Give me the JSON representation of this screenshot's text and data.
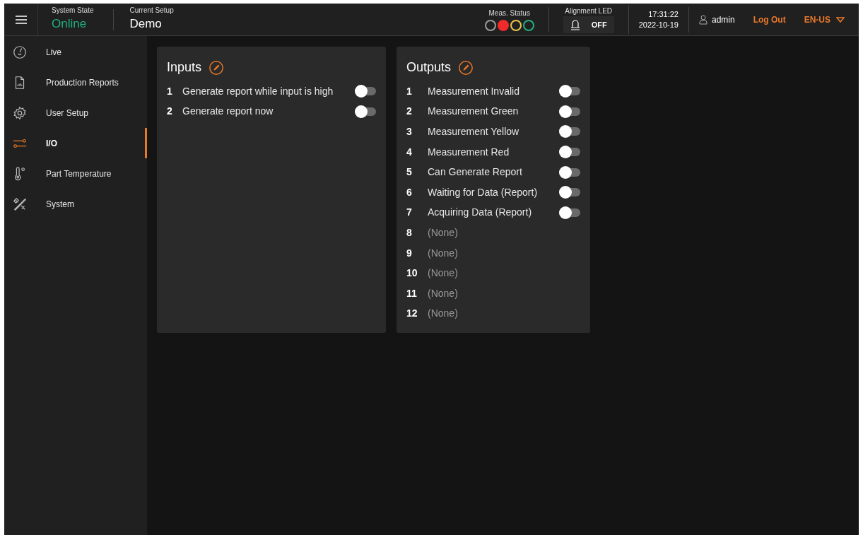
{
  "header": {
    "system_state": {
      "label": "System State",
      "value": "Online"
    },
    "current_setup": {
      "label": "Current Setup",
      "value": "Demo"
    },
    "meas_status": {
      "label": "Meas. Status",
      "dots": [
        {
          "color": "#9e9e9e",
          "filled": false
        },
        {
          "color": "#f02b2b",
          "filled": true
        },
        {
          "color": "#e8c54a",
          "filled": false
        },
        {
          "color": "#22b07d",
          "filled": false
        }
      ]
    },
    "alignment_led": {
      "label": "Alignment LED",
      "value": "OFF"
    },
    "time": "17:31:22",
    "date": "2022-10-19",
    "user": "admin",
    "logout": "Log Out",
    "language": "EN-US"
  },
  "sidebar": {
    "items": [
      {
        "label": "Live",
        "selected": false
      },
      {
        "label": "Production Reports",
        "selected": false
      },
      {
        "label": "User Setup",
        "selected": false
      },
      {
        "label": "I/O",
        "selected": true
      },
      {
        "label": "Part Temperature",
        "selected": false
      },
      {
        "label": "System",
        "selected": false
      }
    ]
  },
  "inputs": {
    "title": "Inputs",
    "rows": [
      {
        "number": "1",
        "label": "Generate report while input is high",
        "kind": "toggle",
        "on": false
      },
      {
        "number": "2",
        "label": "Generate report now",
        "kind": "toggle",
        "on": false
      }
    ]
  },
  "outputs": {
    "title": "Outputs",
    "rows": [
      {
        "number": "1",
        "label": "Measurement Invalid",
        "kind": "toggle",
        "on": false
      },
      {
        "number": "2",
        "label": "Measurement Green",
        "kind": "toggle",
        "on": false
      },
      {
        "number": "3",
        "label": "Measurement Yellow",
        "kind": "toggle",
        "on": false
      },
      {
        "number": "4",
        "label": "Measurement Red",
        "kind": "toggle",
        "on": false
      },
      {
        "number": "5",
        "label": "Can Generate Report",
        "kind": "toggle",
        "on": false
      },
      {
        "number": "6",
        "label": "Waiting for Data (Report)",
        "kind": "toggle",
        "on": false
      },
      {
        "number": "7",
        "label": "Acquiring Data (Report)",
        "kind": "toggle",
        "on": false
      },
      {
        "number": "8",
        "label": "(None)",
        "kind": "empty"
      },
      {
        "number": "9",
        "label": "(None)",
        "kind": "empty"
      },
      {
        "number": "10",
        "label": "(None)",
        "kind": "empty"
      },
      {
        "number": "11",
        "label": "(None)",
        "kind": "empty"
      },
      {
        "number": "12",
        "label": "(None)",
        "kind": "empty"
      }
    ]
  }
}
